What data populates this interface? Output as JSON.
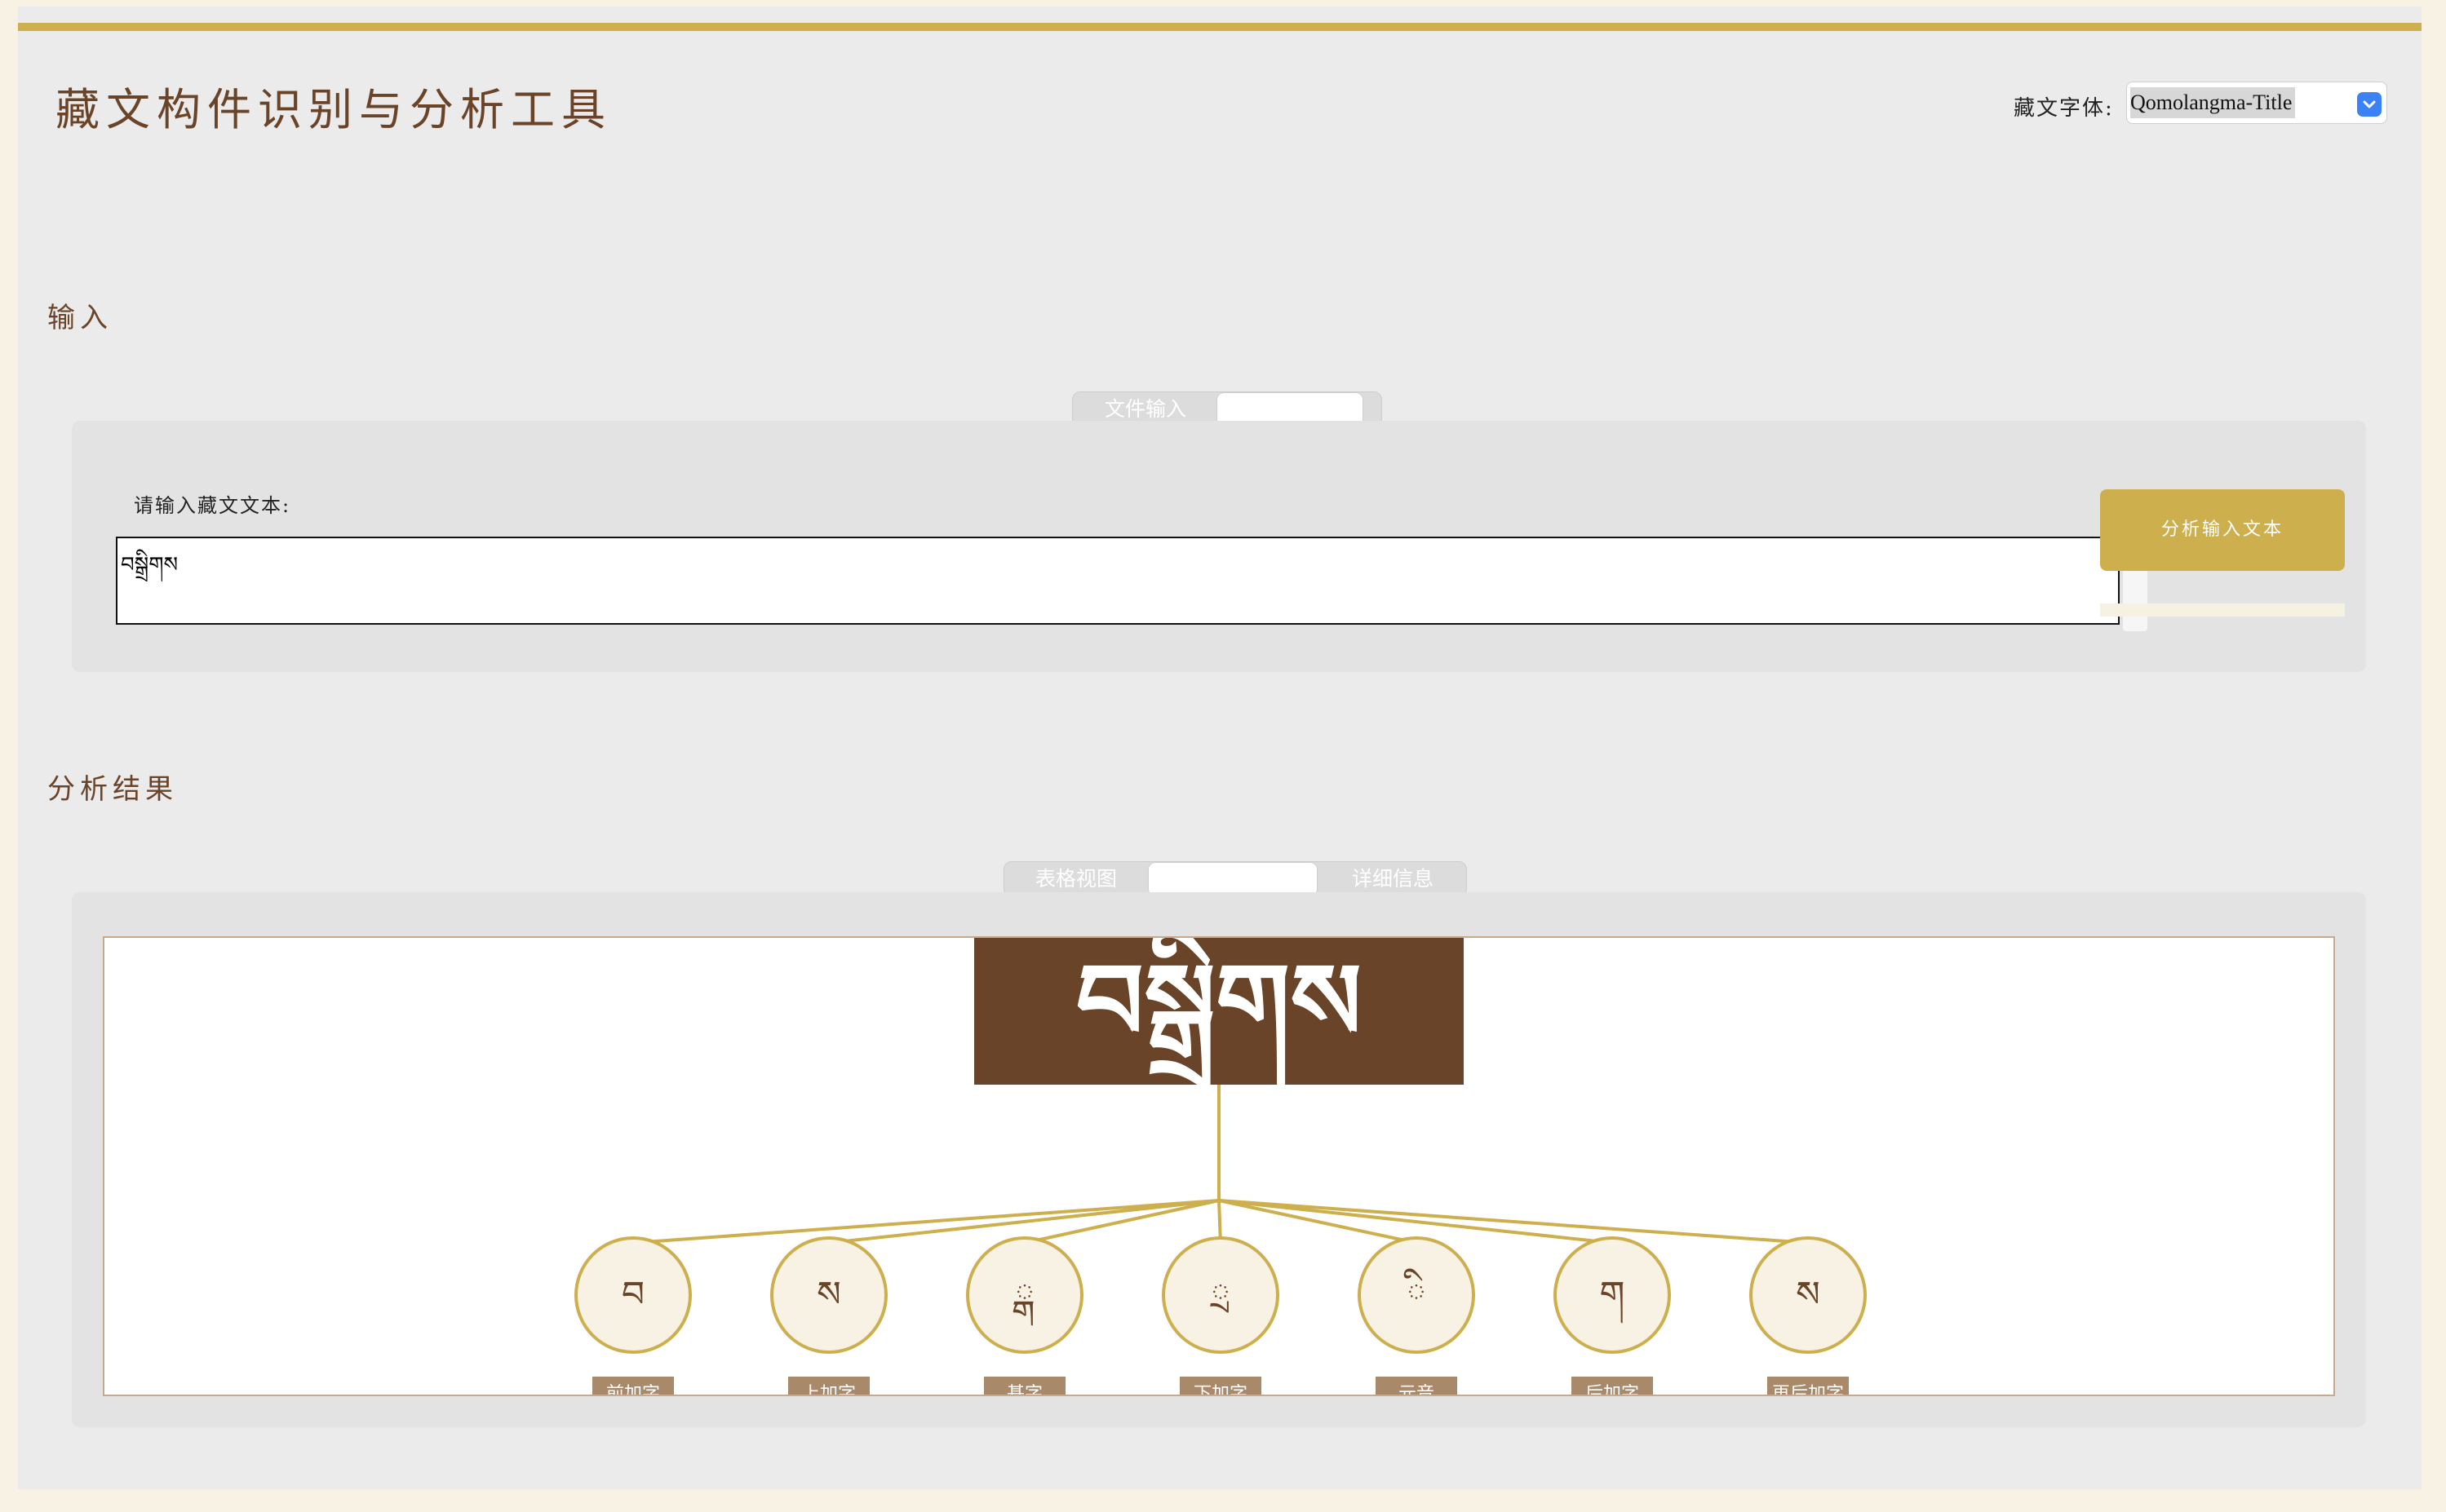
{
  "header": {
    "title": "藏文构件识别与分析工具",
    "font_picker_label": "藏文字体:",
    "font_selected": "Qomolangma-Title"
  },
  "input_section": {
    "title": "输入",
    "tabs": [
      {
        "label": "",
        "active": true
      },
      {
        "label": "文件输入",
        "active": false
      }
    ],
    "prompt": "请输入藏文文本:",
    "text_value": "བསྒྲིགས",
    "analyze_button": "分析输入文本",
    "progress_text": ""
  },
  "results_section": {
    "title": "分析结果",
    "tabs": [
      {
        "label": "表格视图",
        "active": false
      },
      {
        "label": "",
        "active": true
      },
      {
        "label": "详细信息",
        "active": false
      }
    ],
    "tree": {
      "root_text": "བསྒྲིགས",
      "components": [
        {
          "glyph": "བ",
          "role": "前加字"
        },
        {
          "glyph": "ས",
          "role": "上加字"
        },
        {
          "glyph": "ྒ",
          "role": "基字"
        },
        {
          "glyph": "ྲ",
          "role": "下加字"
        },
        {
          "glyph": "ི",
          "role": "元音"
        },
        {
          "glyph": "ག",
          "role": "后加字"
        },
        {
          "glyph": "ས",
          "role": "再后加字"
        }
      ]
    }
  },
  "colors": {
    "accent_gold": "#cdaf4e",
    "title_brown": "#6a4428",
    "root_box": "#6a4428",
    "node_fill": "#f7f2e4",
    "label_fill": "#a88a6a"
  }
}
